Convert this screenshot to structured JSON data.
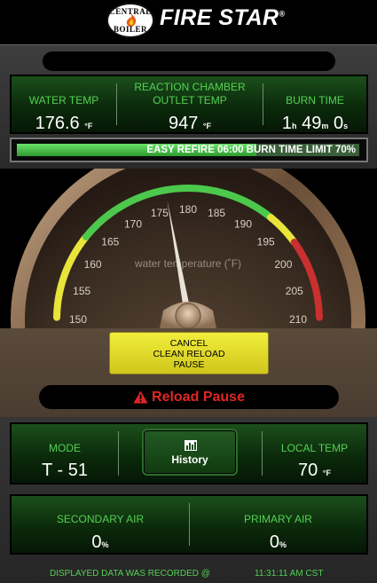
{
  "header": {
    "badge_top": "CENTRAL",
    "badge_bottom": "BOILER",
    "brand": "FIRE STAR",
    "registered": "®"
  },
  "status_bar": {
    "text": ""
  },
  "readings": {
    "water_temp": {
      "label": "WATER TEMP",
      "value": "176.6",
      "unit": "°F"
    },
    "chamber_temp": {
      "label_line1": "REACTION CHAMBER",
      "label_line2": "OUTLET TEMP",
      "value": "947",
      "unit": "°F"
    },
    "burn_time": {
      "label": "BURN TIME",
      "hours": "1",
      "hours_unit": "h",
      "minutes": "49",
      "minutes_unit": "m",
      "seconds": "0",
      "seconds_unit": "s"
    }
  },
  "progress": {
    "text": "EASY REFIRE 06:00 BURN TIME LIMIT 70%",
    "percent": 70,
    "color": "#4fcf4f"
  },
  "gauge": {
    "caption": "water temperature (˚F)",
    "min": 150,
    "max": 210,
    "value": 176.6,
    "ticks": [
      "150",
      "155",
      "160",
      "165",
      "170",
      "175",
      "180",
      "185",
      "190",
      "195",
      "200",
      "205",
      "210"
    ],
    "arc_colors": {
      "low": "#e8e43a",
      "normal": "#4cc84c",
      "warn": "#e8e43a",
      "high": "#c93030"
    }
  },
  "cancel_button": {
    "line1": "CANCEL",
    "line2": "CLEAN RELOAD",
    "line3": "PAUSE"
  },
  "alert": {
    "text": "Reload Pause",
    "color": "#e02525"
  },
  "mode": {
    "label": "MODE",
    "value": "T - 51"
  },
  "history": {
    "label": "History",
    "icon": "bar-chart-icon"
  },
  "local_temp": {
    "label": "LOCAL TEMP",
    "value": "70",
    "unit": "°F"
  },
  "secondary_air": {
    "label": "SECONDARY AIR",
    "value": "0",
    "unit": "%"
  },
  "primary_air": {
    "label": "PRIMARY AIR",
    "value": "0",
    "unit": "%"
  },
  "footer": {
    "recorded_label": "DISPLAYED DATA WAS RECORDED @",
    "time": "11:31:11 AM CST"
  }
}
